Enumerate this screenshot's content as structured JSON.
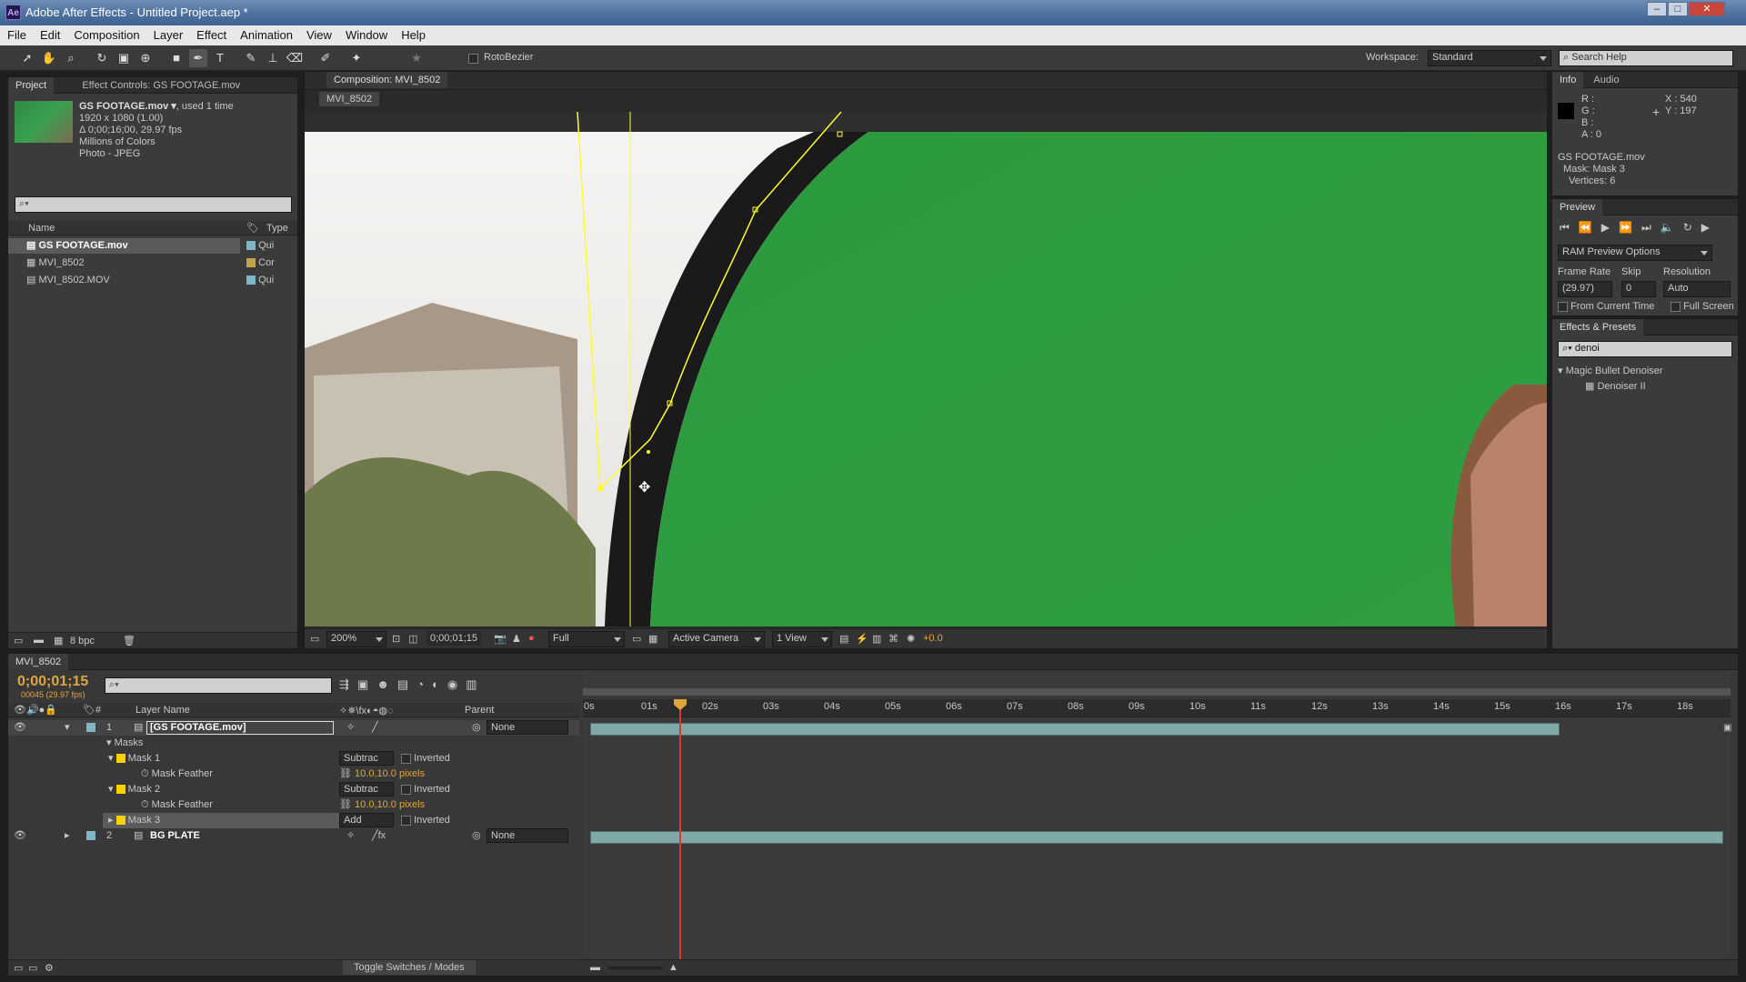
{
  "window": {
    "title": "Adobe After Effects - Untitled Project.aep *",
    "app_badge": "Ae",
    "min": "–",
    "max": "□",
    "close": "✕"
  },
  "menu": [
    "File",
    "Edit",
    "Composition",
    "Layer",
    "Effect",
    "Animation",
    "View",
    "Window",
    "Help"
  ],
  "toolbar": {
    "rotobezier": "RotoBezier",
    "workspace_label": "Workspace:",
    "workspace_value": "Standard",
    "search_placeholder": "Search Help"
  },
  "project": {
    "tab_project": "Project",
    "tab_effect_controls": "Effect Controls: GS FOOTAGE.mov",
    "selected_name": "GS FOOTAGE.mov ▾",
    "used": ", used 1 time",
    "dims": "1920 x 1080 (1.00)",
    "duration": "Δ 0;00;16;00, 29.97 fps",
    "colors": "Millions of Colors",
    "codec": "Photo - JPEG",
    "col_name": "Name",
    "col_type": "Type",
    "items": [
      {
        "name": "GS FOOTAGE.mov",
        "type": "Qui",
        "color": "#7fb7c9"
      },
      {
        "name": "MVI_8502",
        "type": "Cor",
        "color": "#c8a24a"
      },
      {
        "name": "MVI_8502.MOV",
        "type": "Qui",
        "color": "#7fb7c9"
      }
    ],
    "bpc": "8 bpc"
  },
  "comp": {
    "tab": "Composition: MVI_8502",
    "subtab": "MVI_8502",
    "zoom": "200%",
    "timecode": "0;00;01;15",
    "resolution": "Full",
    "camera": "Active Camera",
    "views": "1 View",
    "exposure": "+0.0"
  },
  "info": {
    "tab_info": "Info",
    "tab_audio": "Audio",
    "r": "R :",
    "g": "G :",
    "b": "B :",
    "a": "A : 0",
    "x": "X : 540",
    "y": "Y : 197",
    "line1": "GS FOOTAGE.mov",
    "line2": "Mask: Mask 3",
    "line3": "Vertices: 6"
  },
  "preview": {
    "tab": "Preview",
    "ram": "RAM Preview Options",
    "frame_rate_label": "Frame Rate",
    "skip_label": "Skip",
    "resolution_label": "Resolution",
    "frame_rate": "(29.97)",
    "skip": "0",
    "resolution": "Auto",
    "from_current": "From Current Time",
    "full_screen": "Full Screen"
  },
  "effects": {
    "tab": "Effects & Presets",
    "search": "denoi",
    "group": "Magic Bullet Denoiser",
    "item": "Denoiser II"
  },
  "timeline": {
    "tab": "MVI_8502",
    "timecode": "0;00;01;15",
    "frames": "00045 (29.97 fps)",
    "col_layer": "Layer Name",
    "col_parent": "Parent",
    "ruler": [
      "0s",
      "01s",
      "02s",
      "03s",
      "04s",
      "05s",
      "06s",
      "07s",
      "08s",
      "09s",
      "10s",
      "11s",
      "12s",
      "13s",
      "14s",
      "15s",
      "16s",
      "17s",
      "18s"
    ],
    "layers": [
      {
        "num": "1",
        "name": "[GS FOOTAGE.mov]",
        "parent": "None"
      },
      {
        "num": "2",
        "name": "BG PLATE",
        "parent": "None"
      }
    ],
    "masks_label": "Masks",
    "mask1": "Mask 1",
    "mask2": "Mask 2",
    "mask3": "Mask 3",
    "feather": "Mask Feather",
    "feather_value": "10.0,10.0",
    "feather_unit": "pixels",
    "mode_sub": "Subtrac",
    "mode_add": "Add",
    "inverted": "Inverted",
    "toggle": "Toggle Switches / Modes"
  },
  "colors": {
    "green_screen": "#2f9a3f",
    "mask_path": "#ffff30",
    "playhead": "#d93a2a",
    "timecode": "#e0a63c"
  }
}
